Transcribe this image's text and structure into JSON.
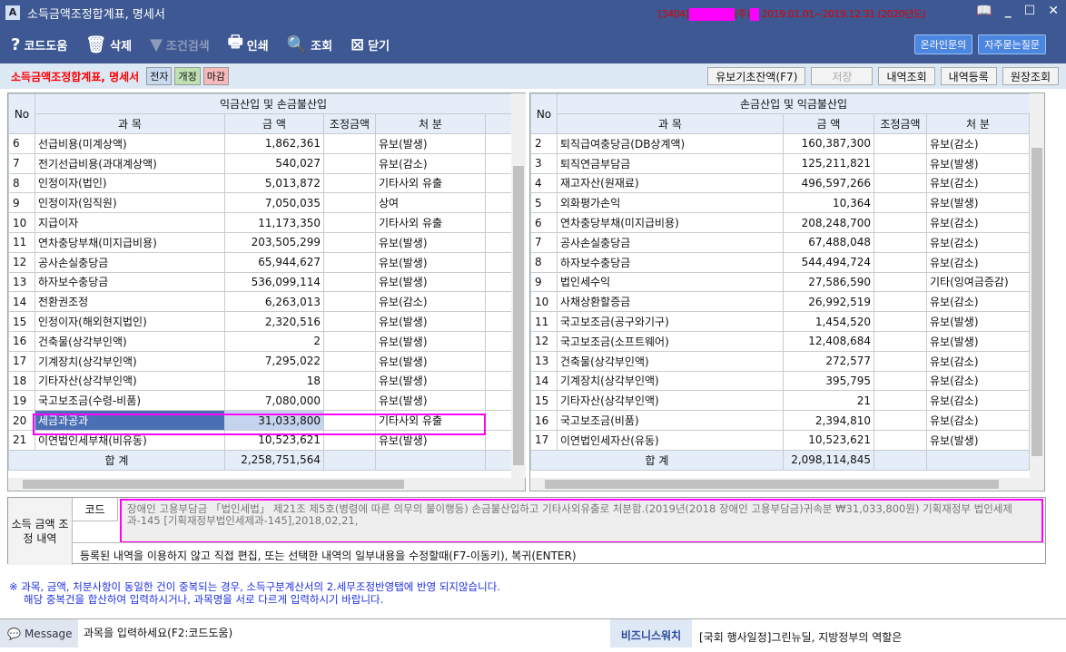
{
  "window": {
    "title": "소득금액조정합계표, 명세서",
    "info_code": "[3404]",
    "info_corp": "(주)",
    "info_period": "2019.01.01~2019.12.31 (2020년도)"
  },
  "toolbar": {
    "code_help": "코드도움",
    "delete": "삭제",
    "filter": "조건검색",
    "print": "인쇄",
    "search": "조회",
    "close": "닫기",
    "online": "온라인문의",
    "faq": "자주묻는질문"
  },
  "subbar": {
    "title": "소득금액조정합계표, 명세서",
    "tags": [
      "전자",
      "개정",
      "마감"
    ],
    "buttons": [
      "유보기초잔액(F7)",
      "저장",
      "내역조회",
      "내역등록",
      "원장조회"
    ]
  },
  "left": {
    "group": "익금산입 및 손금불산입",
    "cols": [
      "No",
      "과 목",
      "금 액",
      "조정금액",
      "처 분"
    ],
    "rows": [
      [
        "6",
        "선급비용(미계상액)",
        "1,862,361",
        "",
        "유보(발생)"
      ],
      [
        "7",
        "전기선급비용(과대계상액)",
        "540,027",
        "",
        "유보(감소)"
      ],
      [
        "8",
        "인정이자(법인)",
        "5,013,872",
        "",
        "기타사외 유출"
      ],
      [
        "9",
        "인정이자(임직원)",
        "7,050,035",
        "",
        "상여"
      ],
      [
        "10",
        "지급이자",
        "11,173,350",
        "",
        "기타사외 유출"
      ],
      [
        "11",
        "연차충당부채(미지급비용)",
        "203,505,299",
        "",
        "유보(발생)"
      ],
      [
        "12",
        "공사손실충당금",
        "65,944,627",
        "",
        "유보(발생)"
      ],
      [
        "13",
        "하자보수충당금",
        "536,099,114",
        "",
        "유보(발생)"
      ],
      [
        "14",
        "전환권조정",
        "6,263,013",
        "",
        "유보(감소)"
      ],
      [
        "15",
        "인정이자(해외현지법인)",
        "2,320,516",
        "",
        "유보(발생)"
      ],
      [
        "16",
        "건축물(상각부인액)",
        "2",
        "",
        "유보(발생)"
      ],
      [
        "17",
        "기계장치(상각부인액)",
        "7,295,022",
        "",
        "유보(발생)"
      ],
      [
        "18",
        "기타자산(상각부인액)",
        "18",
        "",
        "유보(발생)"
      ],
      [
        "19",
        "국고보조금(수령-비품)",
        "7,080,000",
        "",
        "유보(발생)"
      ],
      [
        "20",
        "세금과공과",
        "31,033,800",
        "",
        "기타사외 유출"
      ],
      [
        "21",
        "이연법인세부채(비유동)",
        "10,523,621",
        "",
        "유보(발생)"
      ]
    ],
    "total_label": "합 계",
    "total": "2,258,751,564"
  },
  "right": {
    "group": "손금산입 및 익금불산입",
    "cols": [
      "No",
      "과 목",
      "금 액",
      "조정금액",
      "처 분"
    ],
    "rows": [
      [
        "2",
        "퇴직급여충당금(DB상계액)",
        "160,387,300",
        "",
        "유보(감소)"
      ],
      [
        "3",
        "퇴직연금부담금",
        "125,211,821",
        "",
        "유보(발생)"
      ],
      [
        "4",
        "재고자산(원재료)",
        "496,597,266",
        "",
        "유보(감소)"
      ],
      [
        "5",
        "외화평가손익",
        "10,364",
        "",
        "유보(발생)"
      ],
      [
        "6",
        "연차충당부채(미지급비용)",
        "208,248,700",
        "",
        "유보(감소)"
      ],
      [
        "7",
        "공사손실충당금",
        "67,488,048",
        "",
        "유보(감소)"
      ],
      [
        "8",
        "하자보수충당금",
        "544,494,724",
        "",
        "유보(감소)"
      ],
      [
        "9",
        "법인세수익",
        "27,586,590",
        "",
        "기타(잉여금증감)"
      ],
      [
        "10",
        "사채상환할증금",
        "26,992,519",
        "",
        "유보(감소)"
      ],
      [
        "11",
        "국고보조금(공구와기구)",
        "1,454,520",
        "",
        "유보(발생)"
      ],
      [
        "12",
        "국고보조금(소프트웨어)",
        "12,408,684",
        "",
        "유보(발생)"
      ],
      [
        "13",
        "건축물(상각부인액)",
        "272,577",
        "",
        "유보(감소)"
      ],
      [
        "14",
        "기계장치(상각부인액)",
        "395,795",
        "",
        "유보(감소)"
      ],
      [
        "15",
        "기타자산(상각부인액)",
        "21",
        "",
        "유보(감소)"
      ],
      [
        "16",
        "국고보조금(비품)",
        "2,394,810",
        "",
        "유보(감소)"
      ],
      [
        "17",
        "이연법인세자산(유동)",
        "10,523,621",
        "",
        "유보(발생)"
      ]
    ],
    "total_label": "합 계",
    "total": "2,098,114,845"
  },
  "memo": {
    "label": "소득 금액 조정 내역",
    "code": "코드",
    "text": "장애인 고용부담금 「법인세법」 제21조 제5호(병령에 따른 의무의 불이행등) 손금불산입하고 기타사외유출로 처분함.(2019년(2018 장애인 고용부담금)귀속분 ₩31,033,800원) 기획재정부 법인세제과-145 [기획재정부법인세제과-145],2018,02,21,",
    "hint": "등록된 내역을 이용하지 않고 직접 편집, 또는 선택한 내역의 일부내용을 수정할때(F7-이동키), 복귀(ENTER)"
  },
  "notice": [
    "※ 과목, 금액, 처분사항이 동일한 건이 중복되는 경우, 소득구분계산서의 2.세무조정반영탭에 반영 되지않습니다.",
    "해당 중복건을 합산하여 입력하시거나, 과목명을 서로 다르게 입력하시기 바랍니다."
  ],
  "status": {
    "message_label": "Message",
    "message": "과목을 입력하세요(F2:코드도움)",
    "bw_label": "비즈니스워치",
    "news": "[국회 행사일정]그린뉴딜, 지방정부의 역할은"
  }
}
